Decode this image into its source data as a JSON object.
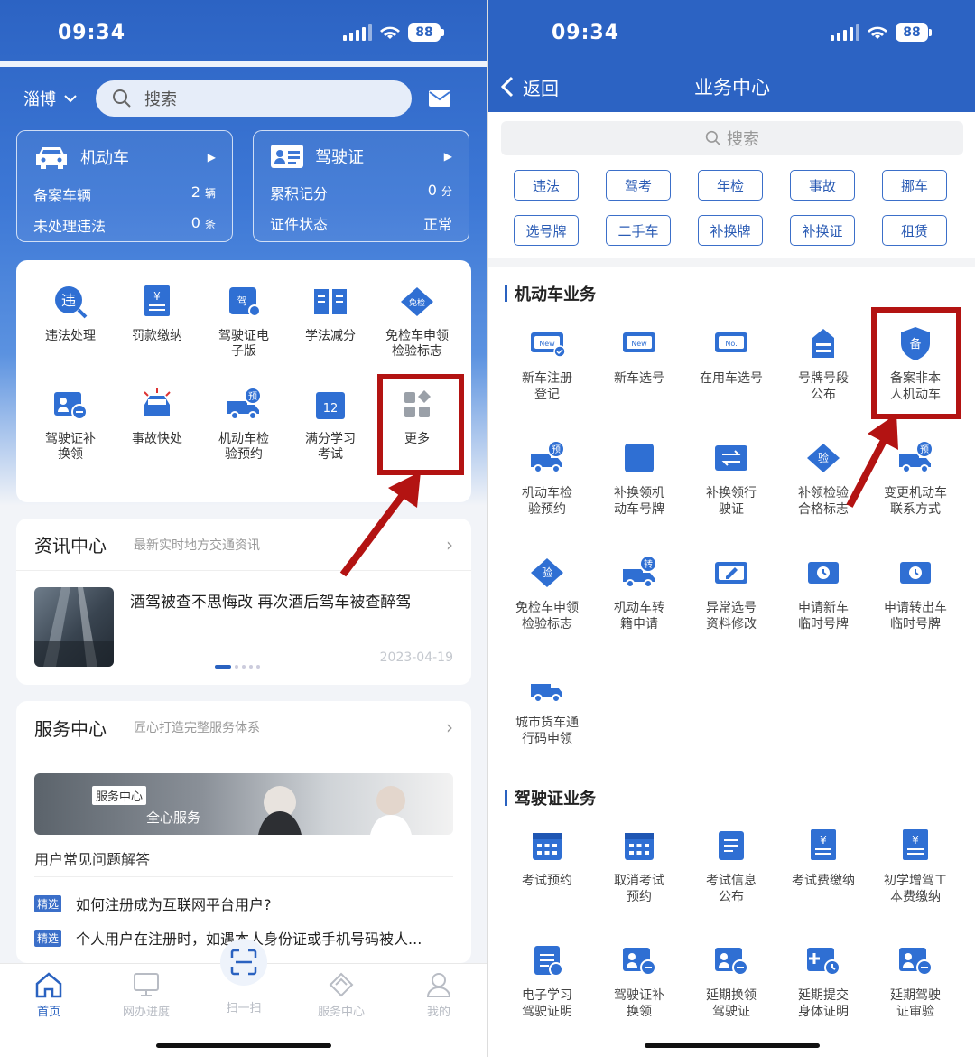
{
  "status": {
    "time": "09:34",
    "battery": "88"
  },
  "left": {
    "city": "淄博",
    "search_placeholder": "搜索",
    "vehicle_card": {
      "title": "机动车",
      "rows": [
        {
          "label": "备案车辆",
          "value": "2",
          "unit": "辆"
        },
        {
          "label": "未处理违法",
          "value": "0",
          "unit": "条"
        }
      ]
    },
    "license_card": {
      "title": "驾驶证",
      "rows": [
        {
          "label": "累积记分",
          "value": "0",
          "unit": "分"
        },
        {
          "label": "证件状态",
          "value": "正常",
          "unit": ""
        }
      ]
    },
    "grid": [
      {
        "l1": "违法处理",
        "l2": "",
        "icon": "violation-icon",
        "badge": "违"
      },
      {
        "l1": "罚款缴纳",
        "l2": "",
        "icon": "fine-receipt-icon",
        "badge": "¥"
      },
      {
        "l1": "驾驶证电",
        "l2": "子版",
        "icon": "e-license-icon",
        "badge": "驾"
      },
      {
        "l1": "学法减分",
        "l2": "",
        "icon": "book-icon",
        "badge": ""
      },
      {
        "l1": "免检车申领",
        "l2": "检验标志",
        "icon": "exempt-badge-icon",
        "badge": "免检"
      },
      {
        "l1": "驾驶证补",
        "l2": "换领",
        "icon": "license-replace-icon",
        "badge": ""
      },
      {
        "l1": "事故快处",
        "l2": "",
        "icon": "accident-car-icon",
        "badge": ""
      },
      {
        "l1": "机动车检",
        "l2": "验预约",
        "icon": "inspection-truck-icon",
        "badge": "预"
      },
      {
        "l1": "满分学习",
        "l2": "考试",
        "icon": "calendar-icon",
        "badge": "12"
      },
      {
        "l1": "更多",
        "l2": "",
        "icon": "more-grid-icon",
        "badge": ""
      }
    ],
    "news": {
      "title": "资讯中心",
      "subtitle": "最新实时地方交通资讯",
      "headline": "酒驾被查不思悔改 再次酒后驾车被查醉驾",
      "date": "2023-04-19"
    },
    "service": {
      "title": "服务中心",
      "subtitle": "匠心打造完整服务体系",
      "banner_tag": "服务中心",
      "banner_text": "全心服务",
      "faq_title": "用户常见问题解答",
      "faq_tag": "精选",
      "faqs": [
        "如何注册成为互联网平台用户?",
        "个人用户在注册时，如遇本人身份证或手机号码被人..."
      ]
    },
    "tabs": [
      {
        "label": "首页",
        "icon": "home-icon"
      },
      {
        "label": "网办进度",
        "icon": "monitor-icon"
      },
      {
        "label": "扫一扫",
        "icon": "scan-icon"
      },
      {
        "label": "服务中心",
        "icon": "diamond-icon"
      },
      {
        "label": "我的",
        "icon": "user-icon"
      }
    ]
  },
  "right": {
    "back": "返回",
    "title": "业务中心",
    "search_placeholder": "搜索",
    "chips": [
      "违法",
      "驾考",
      "年检",
      "事故",
      "挪车",
      "选号牌",
      "二手车",
      "补换牌",
      "补换证",
      "租赁"
    ],
    "vehicle_section": "机动车业务",
    "vehicle_items": [
      {
        "l1": "新车注册",
        "l2": "登记",
        "icon": "new-plate-check-icon"
      },
      {
        "l1": "新车选号",
        "l2": "",
        "icon": "new-plate-icon"
      },
      {
        "l1": "在用车选号",
        "l2": "",
        "icon": "plate-no-icon"
      },
      {
        "l1": "号牌号段",
        "l2": "公布",
        "icon": "plate-announce-icon"
      },
      {
        "l1": "备案非本",
        "l2": "人机动车",
        "icon": "shield-icon"
      },
      {
        "l1": "机动车检",
        "l2": "验预约",
        "icon": "inspection-truck-icon"
      },
      {
        "l1": "补换领机",
        "l2": "动车号牌",
        "icon": "plate-swap-icon"
      },
      {
        "l1": "补换领行",
        "l2": "驶证",
        "icon": "car-swap-icon"
      },
      {
        "l1": "补领检验",
        "l2": "合格标志",
        "icon": "verify-badge-icon"
      },
      {
        "l1": "变更机动车",
        "l2": "联系方式",
        "icon": "car-phone-icon"
      },
      {
        "l1": "免检车申领",
        "l2": "检验标志",
        "icon": "exempt-badge-icon"
      },
      {
        "l1": "机动车转",
        "l2": "籍申请",
        "icon": "truck-transfer-icon"
      },
      {
        "l1": "异常选号",
        "l2": "资料修改",
        "icon": "plate-edit-icon"
      },
      {
        "l1": "申请新车",
        "l2": "临时号牌",
        "icon": "temp-plate-icon"
      },
      {
        "l1": "申请转出车",
        "l2": "临时号牌",
        "icon": "temp-plate-out-icon"
      },
      {
        "l1": "城市货车通",
        "l2": "行码申领",
        "icon": "truck-pass-icon"
      }
    ],
    "license_section": "驾驶证业务",
    "license_items": [
      {
        "l1": "考试预约",
        "l2": "",
        "icon": "exam-calendar-icon"
      },
      {
        "l1": "取消考试",
        "l2": "预约",
        "icon": "cancel-calendar-icon"
      },
      {
        "l1": "考试信息",
        "l2": "公布",
        "icon": "exam-info-icon"
      },
      {
        "l1": "考试费缴纳",
        "l2": "",
        "icon": "fee-icon"
      },
      {
        "l1": "初学增驾工",
        "l2": "本费缴纳",
        "icon": "cost-list-icon"
      },
      {
        "l1": "电子学习",
        "l2": "驾驶证明",
        "icon": "e-learning-icon"
      },
      {
        "l1": "驾驶证补",
        "l2": "换领",
        "icon": "license-replace-icon"
      },
      {
        "l1": "延期换领",
        "l2": "驾驶证",
        "icon": "license-delay-icon"
      },
      {
        "l1": "延期提交",
        "l2": "身体证明",
        "icon": "health-delay-icon"
      },
      {
        "l1": "延期驾驶",
        "l2": "证审验",
        "icon": "license-verify-icon"
      }
    ]
  },
  "colors": {
    "primary": "#2c63c3",
    "icon_blue": "#2f6fd3",
    "highlight_red": "#b31312"
  }
}
